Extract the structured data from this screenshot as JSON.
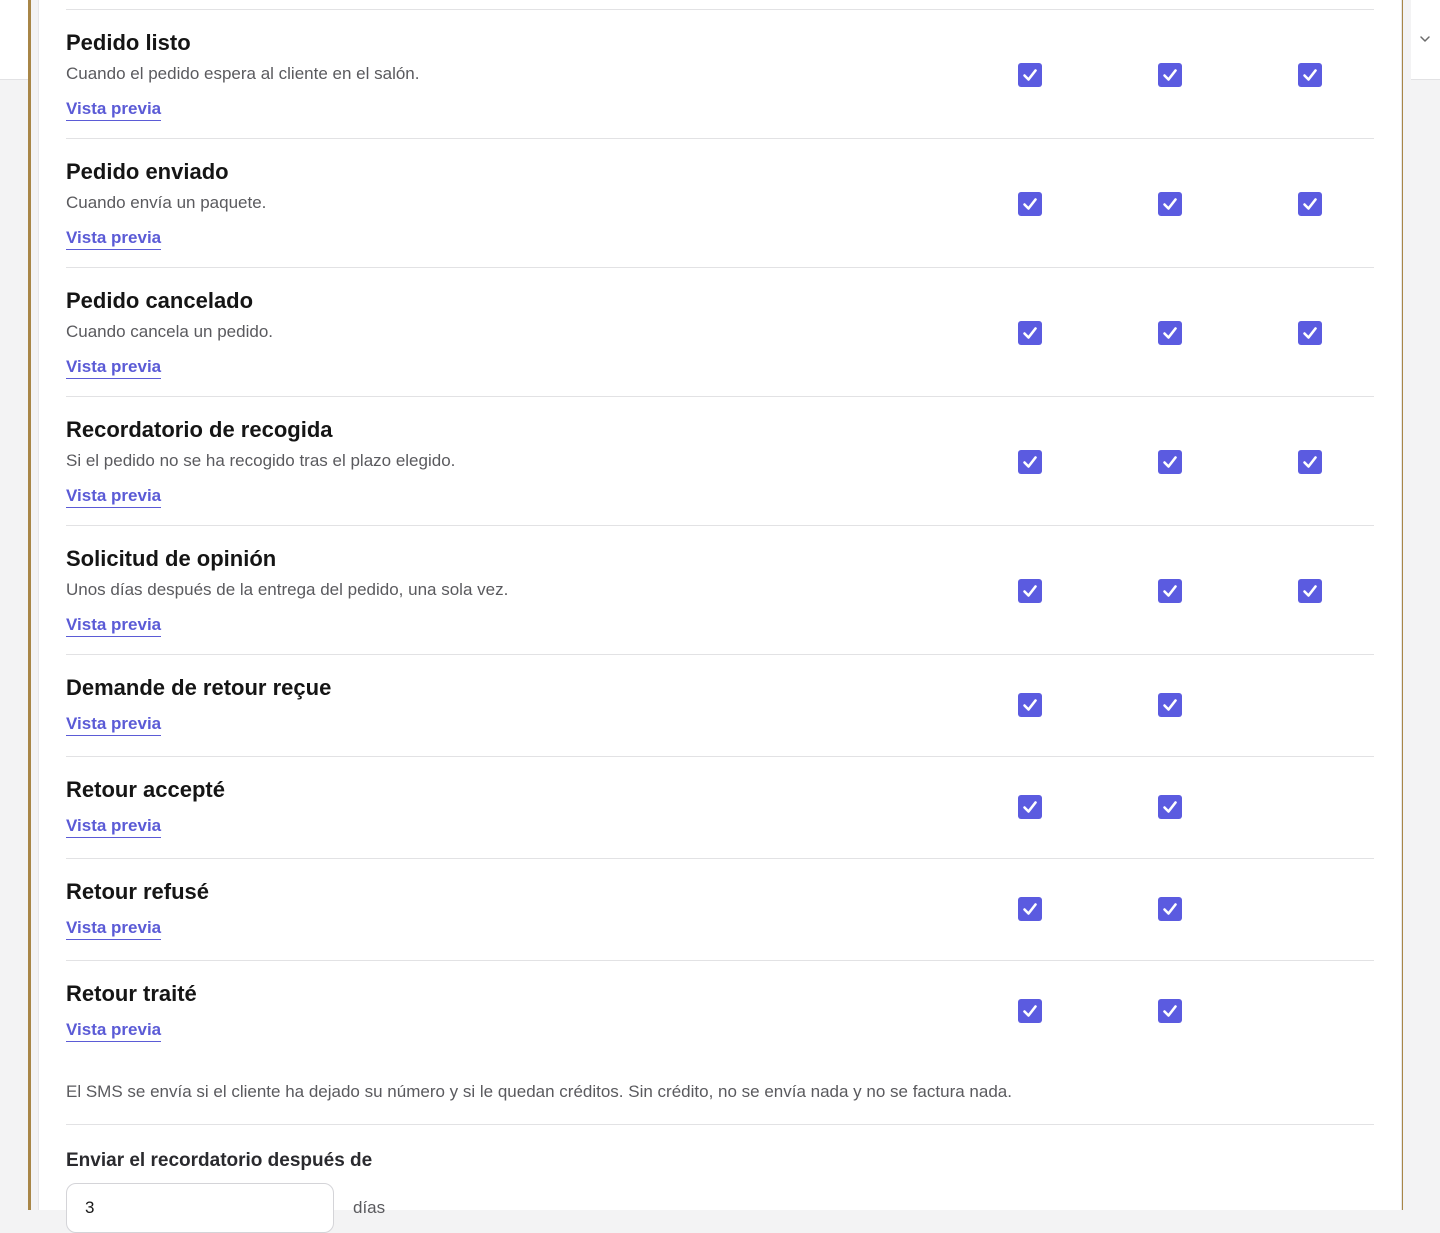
{
  "notifications": [
    {
      "title": "Pedido listo",
      "description": "Cuando el pedido espera al cliente en el salón.",
      "preview_label": "Vista previa",
      "channels": [
        true,
        true,
        true
      ]
    },
    {
      "title": "Pedido enviado",
      "description": "Cuando envía un paquete.",
      "preview_label": "Vista previa",
      "channels": [
        true,
        true,
        true
      ]
    },
    {
      "title": "Pedido cancelado",
      "description": "Cuando cancela un pedido.",
      "preview_label": "Vista previa",
      "channels": [
        true,
        true,
        true
      ]
    },
    {
      "title": "Recordatorio de recogida",
      "description": "Si el pedido no se ha recogido tras el plazo elegido.",
      "preview_label": "Vista previa",
      "channels": [
        true,
        true,
        true
      ]
    },
    {
      "title": "Solicitud de opinión",
      "description": "Unos días después de la entrega del pedido, una sola vez.",
      "preview_label": "Vista previa",
      "channels": [
        true,
        true,
        true
      ]
    },
    {
      "title": "Demande de retour reçue",
      "description": "",
      "preview_label": "Vista previa",
      "channels": [
        true,
        true
      ]
    },
    {
      "title": "Retour accepté",
      "description": "",
      "preview_label": "Vista previa",
      "channels": [
        true,
        true
      ]
    },
    {
      "title": "Retour refusé",
      "description": "",
      "preview_label": "Vista previa",
      "channels": [
        true,
        true
      ]
    },
    {
      "title": "Retour traité",
      "description": "",
      "preview_label": "Vista previa",
      "channels": [
        true,
        true
      ]
    }
  ],
  "footnote": "El SMS se envía si el cliente ha dejado su número y si le quedan créditos. Sin crédito, no se envía nada y no se factura nada.",
  "reminder": {
    "label": "Enviar el recordatorio después de",
    "value": "3",
    "unit": "días"
  },
  "colors": {
    "accent": "#5b5be0",
    "frame": "#a88647",
    "link": "#5b5bd6"
  }
}
